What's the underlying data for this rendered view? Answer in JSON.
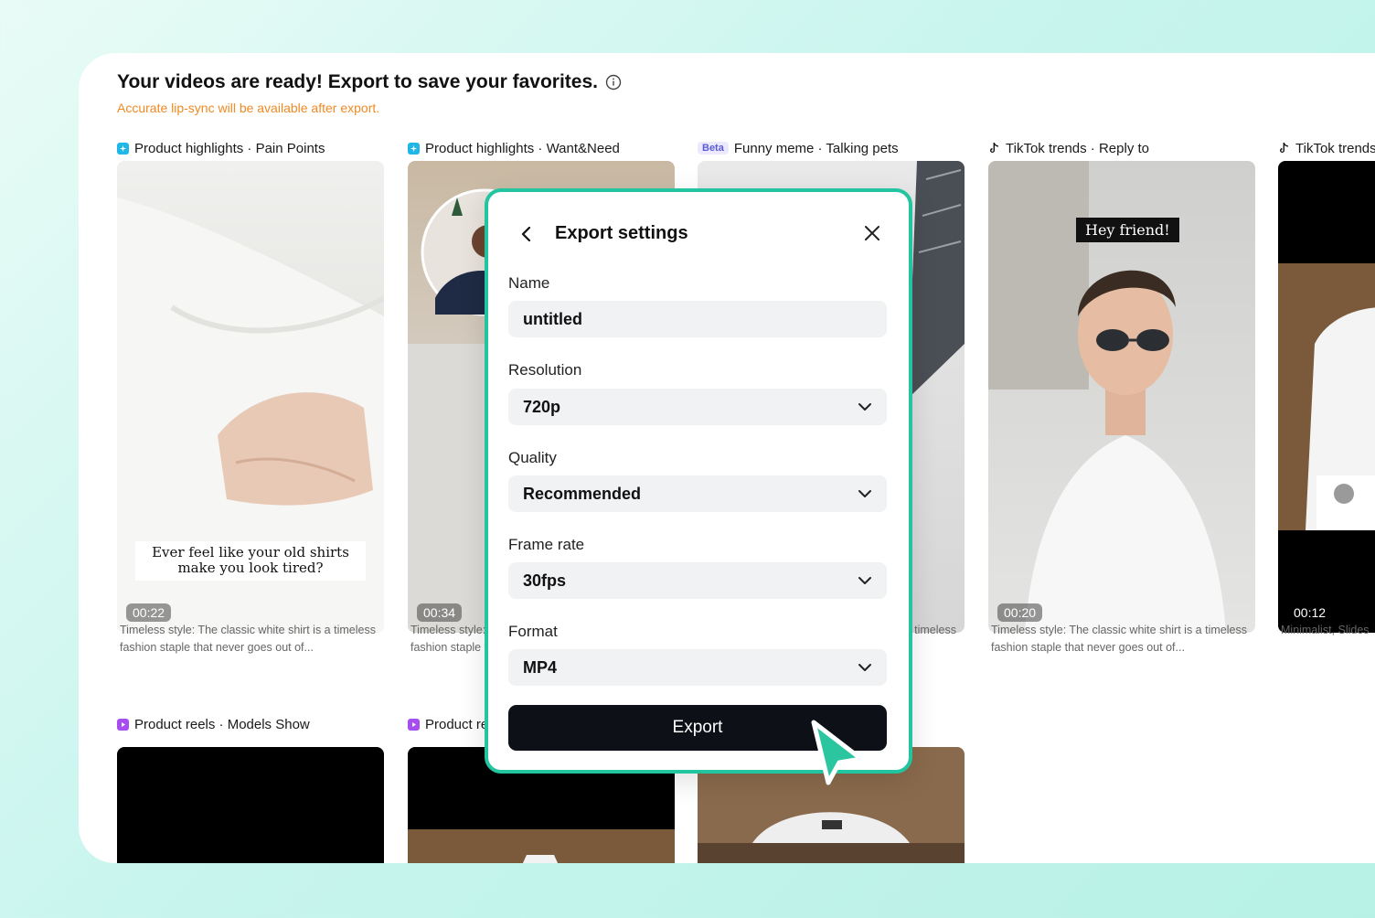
{
  "header": {
    "title": "Your videos are ready! Export to save your favorites.",
    "note": "Accurate lip-sync will be available after export."
  },
  "cards": [
    {
      "label": "Product highlights · Pain Points",
      "tag": "highlight-icon",
      "duration": "00:22",
      "caption": "Ever feel like your old shirts make you look tired?",
      "description": "Timeless style: The classic white shirt is a timeless fashion staple that never goes out of..."
    },
    {
      "label": "Product highlights · Want&Need",
      "tag": "highlight-icon",
      "duration": "00:34",
      "description": "Timeless style: The classic white shirt is a timeless fashion staple that never goes out of..."
    },
    {
      "label": "Funny meme · Talking pets",
      "badge": "Beta",
      "description": "Timeless style: The classic white shirt is a timeless fashion staple that never goes out of..."
    },
    {
      "label": "TikTok trends · Reply to",
      "tag": "tiktok-icon",
      "duration": "00:20",
      "caption": "Hey friend!",
      "description": "Timeless style: The classic white shirt is a timeless fashion staple that never goes out of..."
    },
    {
      "label": "TikTok trends · Reply to",
      "tag": "tiktok-icon",
      "duration": "00:12",
      "description": "Minimalist, Slides"
    },
    {
      "label": "Product reels · Models Show",
      "tag": "reels-icon"
    },
    {
      "label": "Product reels · Models Show",
      "tag": "reels-icon"
    }
  ],
  "modal": {
    "title": "Export settings",
    "name_label": "Name",
    "name_value": "untitled",
    "resolution_label": "Resolution",
    "resolution_value": "720p",
    "quality_label": "Quality",
    "quality_value": "Recommended",
    "framerate_label": "Frame rate",
    "framerate_value": "30fps",
    "format_label": "Format",
    "format_value": "MP4",
    "export_label": "Export"
  },
  "colors": {
    "accent": "#23c4a0",
    "warning": "#f08a24",
    "button": "#0d1117"
  }
}
